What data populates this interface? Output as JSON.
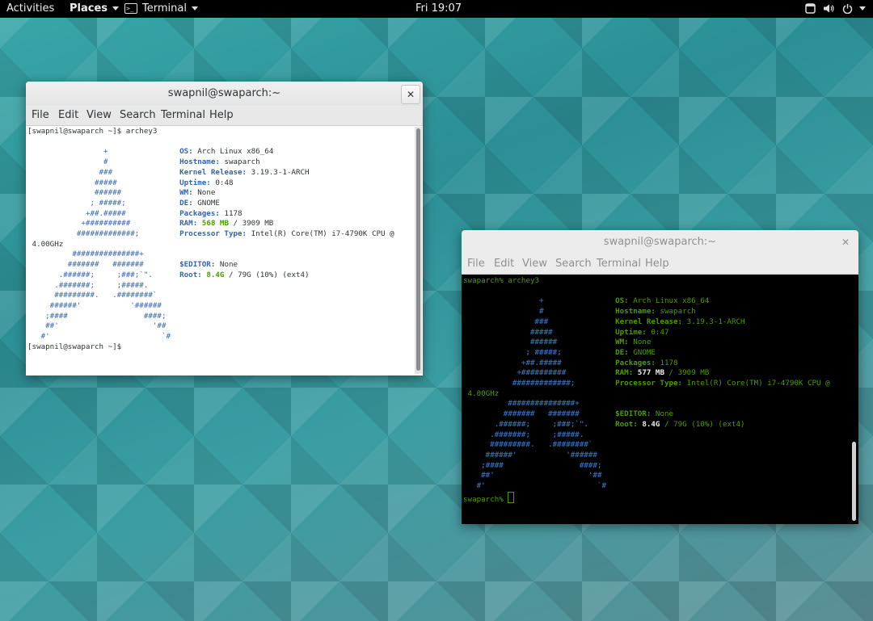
{
  "topbar": {
    "activities": "Activities",
    "places": "Places",
    "app": "Terminal",
    "clock": "Fri 19:07",
    "icons": [
      "window-icon",
      "volume-icon",
      "power-icon"
    ]
  },
  "win1": {
    "title": "swapnil@swaparch:~",
    "close": "✕",
    "menu": [
      "File",
      "Edit",
      "View",
      "Search",
      "Terminal",
      "Help"
    ],
    "prompt": "[swapnil@swaparch ~]$ ",
    "command": "archey3",
    "prompt_end": "[swapnil@swaparch ~]$",
    "info": {
      "os_label": "OS:",
      "os": "Arch Linux x86_64",
      "host_label": "Hostname:",
      "host": "swaparch",
      "kernel_label": "Kernel Release:",
      "kernel": "3.19.3-1-ARCH",
      "uptime_label": "Uptime:",
      "uptime": "0:48",
      "wm_label": "WM:",
      "wm": "None",
      "de_label": "DE:",
      "de": "GNOME",
      "pkg_label": "Packages:",
      "pkg": "1178",
      "ram_label": "RAM:",
      "ram_used": "568 MB",
      "ram_total": "/ 3909 MB",
      "cpu_label": "Processor Type:",
      "cpu": "Intel(R) Core(TM) i7-4790K CPU @",
      "cpu_cont": "4.00GHz",
      "editor_label": "$EDITOR:",
      "editor": "None",
      "root_label": "Root:",
      "root_used": "8.4G",
      "root_rest": "/ 79G (10%) (ext4)"
    }
  },
  "win2": {
    "title": "swapnil@swaparch:~",
    "close": "✕",
    "menu": [
      "File",
      "Edit",
      "View",
      "Search",
      "Terminal",
      "Help"
    ],
    "prompt": "swaparch% ",
    "command": "archey3",
    "prompt_end": "swaparch% ",
    "info": {
      "os_label": "OS:",
      "os": "Arch Linux x86_64",
      "host_label": "Hostname:",
      "host": "swaparch",
      "kernel_label": "Kernel Release:",
      "kernel": "3.19.3-1-ARCH",
      "uptime_label": "Uptime:",
      "uptime": "0:47",
      "wm_label": "WM:",
      "wm": "None",
      "de_label": "DE:",
      "de": "GNOME",
      "pkg_label": "Packages:",
      "pkg": "1178",
      "ram_label": "RAM:",
      "ram_used": "577 MB",
      "ram_total": "/ 3909 MB",
      "cpu_label": "Processor Type:",
      "cpu": "Intel(R) Core(TM) i7-4790K CPU @",
      "cpu_cont": "4.00GHz",
      "editor_label": "$EDITOR:",
      "editor": "None",
      "root_label": "Root:",
      "root_used": "8.4G",
      "root_rest": "/ 79G (10%) (ext4)"
    }
  },
  "art": [
    "               +                ",
    "               #                ",
    "              ###               ",
    "             #####              ",
    "             ######             ",
    "            ; #####;            ",
    "           +##.#####            ",
    "          +##########           ",
    "         #############;         ",
    "        ###############+        ",
    "       #######   #######        ",
    "     .######;     ;###;`\".      ",
    "    .#######;     ;#####.       ",
    "    #########.   .########`     ",
    "   ######'           '######    ",
    "  ;####                 ####;   ",
    "  ##'                     '##   ",
    " #'                         `#  "
  ]
}
